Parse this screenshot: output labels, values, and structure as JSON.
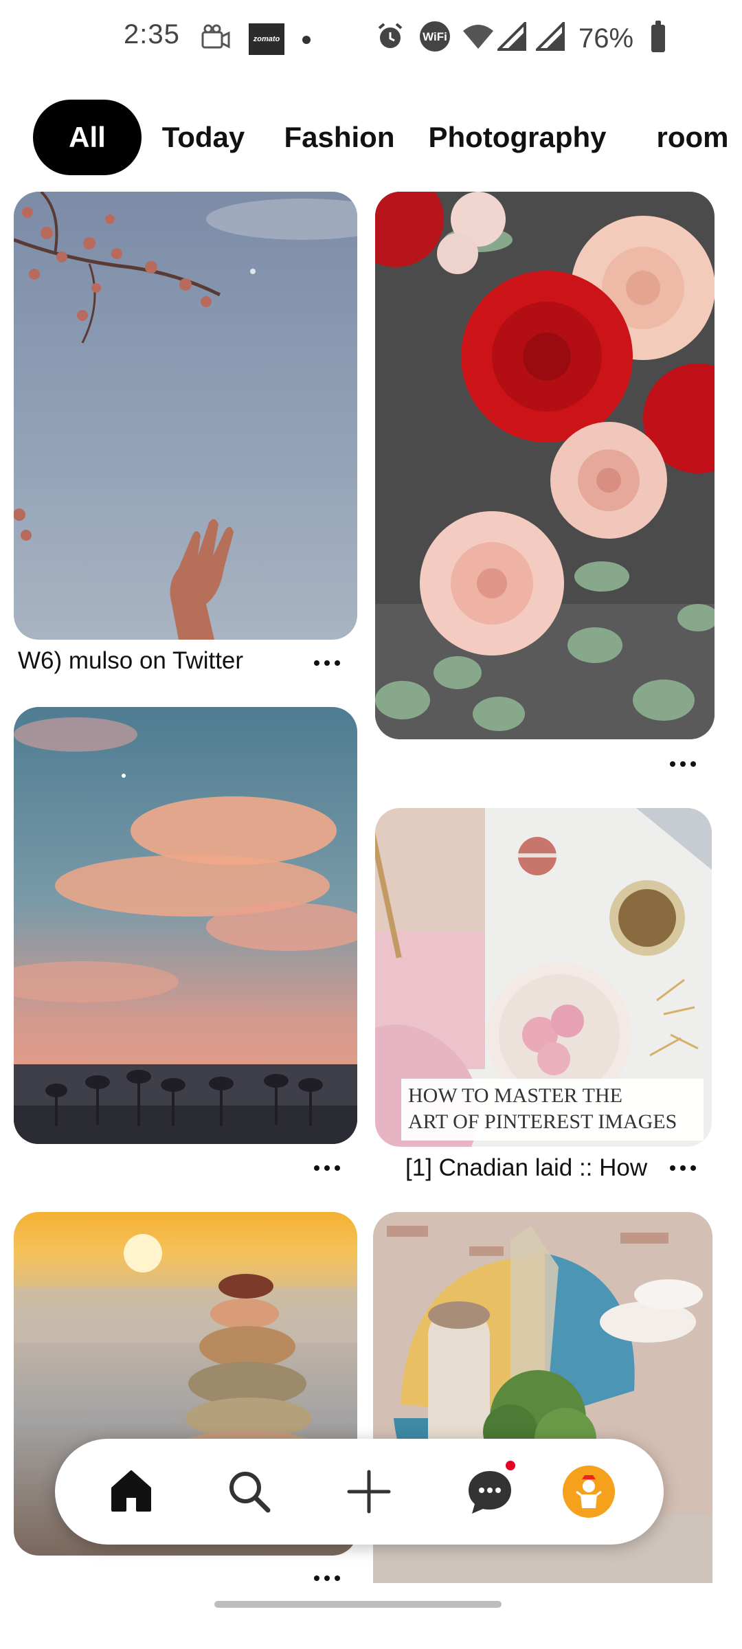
{
  "status_bar": {
    "time": "2:35",
    "battery": "76%",
    "icons": [
      "video-camera-icon",
      "zomato-app-icon",
      "notification-dot-icon",
      "alarm-icon",
      "wifi-calling-icon",
      "wifi-icon",
      "signal-icon",
      "signal-icon",
      "battery-icon"
    ],
    "zomato_label": "zomato"
  },
  "tabs": [
    {
      "label": "All",
      "active": true
    },
    {
      "label": "Today",
      "active": false
    },
    {
      "label": "Fashion",
      "active": false
    },
    {
      "label": "Photography",
      "active": false
    },
    {
      "label": "room",
      "active": false
    }
  ],
  "pins": [
    {
      "caption": "W6) mulso on Twitter",
      "image": "cherry blossom branch and hand against blue sky"
    },
    {
      "caption": "",
      "image": "red and pink roses with eucalyptus on dark background"
    },
    {
      "caption": "",
      "image": "sunset clouds over sea with palm trees"
    },
    {
      "caption": "[1] Cnadian laid :: How",
      "image": "macarons, coffee, pink flatlay",
      "overlay_line1": "HOW TO MASTER THE",
      "overlay_line2": "ART OF PINTEREST IMAGES"
    },
    {
      "caption": "",
      "image": "stacked sea glass stones at sunset beach"
    },
    {
      "caption": "",
      "image": "collage art with arch and plant on brick wall"
    }
  ],
  "bottom_nav": {
    "items": [
      "home-icon",
      "search-icon",
      "add-icon",
      "messages-icon",
      "profile-avatar"
    ],
    "active": "home-icon"
  },
  "colors": {
    "accent": "#e60023",
    "tab_active_bg": "#000000",
    "avatar_bg": "#f6a11c"
  }
}
